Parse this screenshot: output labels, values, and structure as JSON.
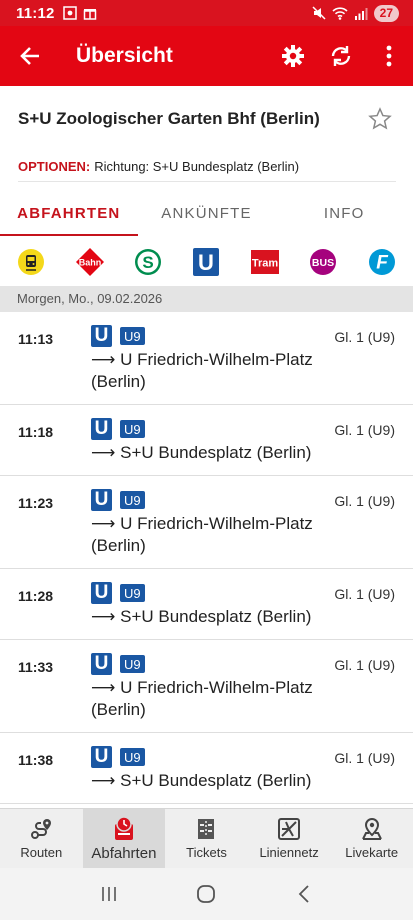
{
  "status": {
    "time": "11:12",
    "battery": "27"
  },
  "appbar": {
    "title": "Übersicht"
  },
  "station": {
    "name": "S+U Zoologischer Garten Bhf (Berlin)"
  },
  "options": {
    "label": "OPTIONEN:",
    "text": "Richtung: S+U Bundesplatz (Berlin)"
  },
  "tabs": [
    {
      "label": "ABFAHRTEN",
      "active": true
    },
    {
      "label": "ANKÜNFTE",
      "active": false
    },
    {
      "label": "INFO",
      "active": false
    }
  ],
  "modes": [
    {
      "icon": "bahn-yellow-icon",
      "label": ""
    },
    {
      "icon": "bahn-icon",
      "label": "Bahn"
    },
    {
      "icon": "s-bahn-icon",
      "label": "S"
    },
    {
      "icon": "u-bahn-icon",
      "label": "U"
    },
    {
      "icon": "tram-icon",
      "label": "Tram"
    },
    {
      "icon": "bus-icon",
      "label": "BUS"
    },
    {
      "icon": "ferry-icon",
      "label": "F"
    }
  ],
  "date_header": "Morgen, Mo., 09.02.2026",
  "departures": [
    {
      "time": "11:13",
      "mode": "U",
      "line": "U9",
      "dest_line1": "U Friedrich-Wilhelm-Platz",
      "dest_line2": "(Berlin)",
      "platform": "Gl. 1 (U9)"
    },
    {
      "time": "11:18",
      "mode": "U",
      "line": "U9",
      "dest_line1": "S+U Bundesplatz (Berlin)",
      "dest_line2": "",
      "platform": "Gl. 1 (U9)"
    },
    {
      "time": "11:23",
      "mode": "U",
      "line": "U9",
      "dest_line1": "U Friedrich-Wilhelm-Platz",
      "dest_line2": "(Berlin)",
      "platform": "Gl. 1 (U9)"
    },
    {
      "time": "11:28",
      "mode": "U",
      "line": "U9",
      "dest_line1": "S+U Bundesplatz (Berlin)",
      "dest_line2": "",
      "platform": "Gl. 1 (U9)"
    },
    {
      "time": "11:33",
      "mode": "U",
      "line": "U9",
      "dest_line1": "U Friedrich-Wilhelm-Platz",
      "dest_line2": "(Berlin)",
      "platform": "Gl. 1 (U9)"
    },
    {
      "time": "11:38",
      "mode": "U",
      "line": "U9",
      "dest_line1": "S+U Bundesplatz (Berlin)",
      "dest_line2": "",
      "platform": "Gl. 1 (U9)"
    }
  ],
  "bottom_nav": [
    {
      "label": "Routen",
      "icon": "route-icon"
    },
    {
      "label": "Abfahrten",
      "icon": "departures-icon",
      "active": true
    },
    {
      "label": "Tickets",
      "icon": "ticket-icon"
    },
    {
      "label": "Liniennetz",
      "icon": "network-map-icon"
    },
    {
      "label": "Livekarte",
      "icon": "live-map-icon"
    }
  ],
  "colors": {
    "primary": "#e30613",
    "ubahn": "#1a57a3",
    "sbahn": "#008d4f",
    "tram": "#d9131f",
    "bus": "#a5027d",
    "ferry": "#0099d6"
  }
}
